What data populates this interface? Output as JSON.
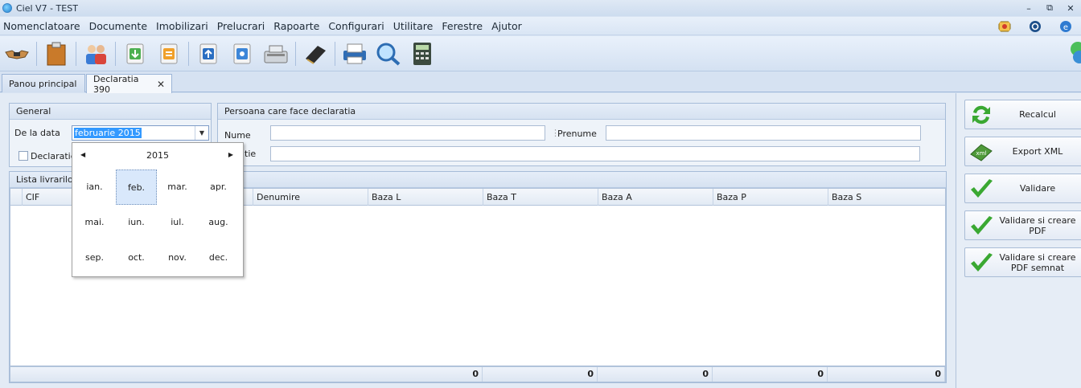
{
  "window": {
    "title": "Ciel V7 - TEST"
  },
  "menu": [
    "Nomenclatoare",
    "Documente",
    "Imobilizari",
    "Prelucrari",
    "Rapoarte",
    "Configurari",
    "Utilitare",
    "Ferestre",
    "Ajutor"
  ],
  "tabs": {
    "home": "Panou principal",
    "active": "Declaratia 390"
  },
  "general": {
    "title": "General",
    "date_label": "De la data",
    "date_value": "februarie 2015",
    "checkbox_label": "Declaratie"
  },
  "person": {
    "title": "Persoana care face declaratia",
    "name_label": "Nume",
    "firstname_label": "Prenume",
    "role_label": "tie",
    "name_value": "",
    "firstname_value": "",
    "role_value": ""
  },
  "list": {
    "title": "Lista livrarilor/",
    "columns": [
      "CIF",
      "Denumire",
      "Baza L",
      "Baza T",
      "Baza A",
      "Baza P",
      "Baza S"
    ],
    "totals": [
      "0",
      "0",
      "0",
      "0",
      "0"
    ]
  },
  "actions": {
    "recalc": "Recalcul",
    "export_xml": "Export XML",
    "validate": "Validare",
    "validate_pdf": "Validare si creare PDF",
    "validate_pdf_signed": "Validare si creare PDF semnat"
  },
  "picker": {
    "year": "2015",
    "months": [
      "ian.",
      "feb.",
      "mar.",
      "apr.",
      "mai.",
      "iun.",
      "iul.",
      "aug.",
      "sep.",
      "oct.",
      "nov.",
      "dec."
    ],
    "selected_month": "feb."
  },
  "colors": {
    "selection": "#3399ff",
    "accent_green": "#3aa832"
  }
}
